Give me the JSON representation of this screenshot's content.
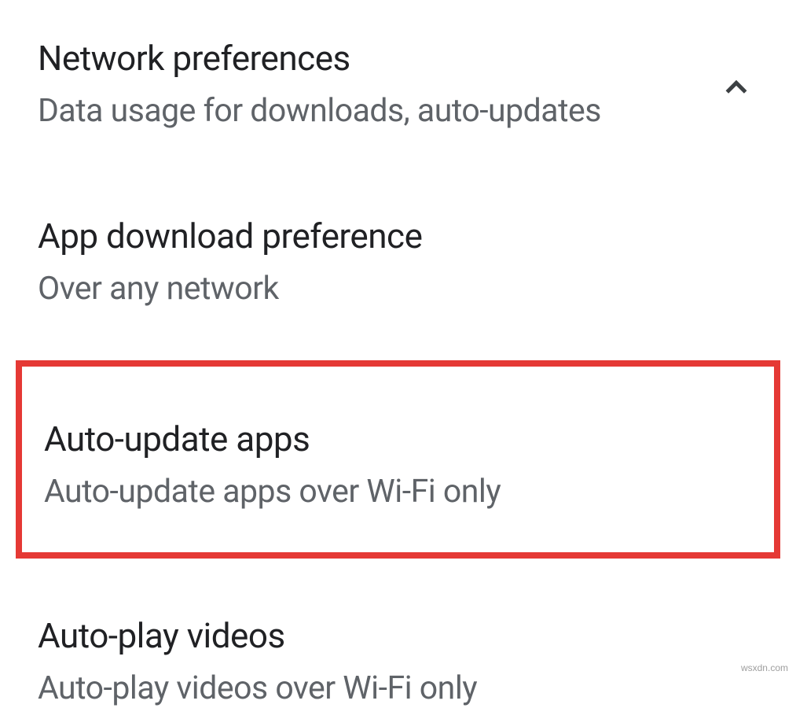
{
  "header": {
    "title": "Network preferences",
    "subtitle": "Data usage for downloads, auto-updates"
  },
  "items": [
    {
      "title": "App download preference",
      "value": "Over any network"
    },
    {
      "title": "Auto-update apps",
      "value": "Auto-update apps over Wi-Fi only"
    },
    {
      "title": "Auto-play videos",
      "value": "Auto-play videos over Wi-Fi only"
    }
  ],
  "watermark": "wsxdn.com"
}
